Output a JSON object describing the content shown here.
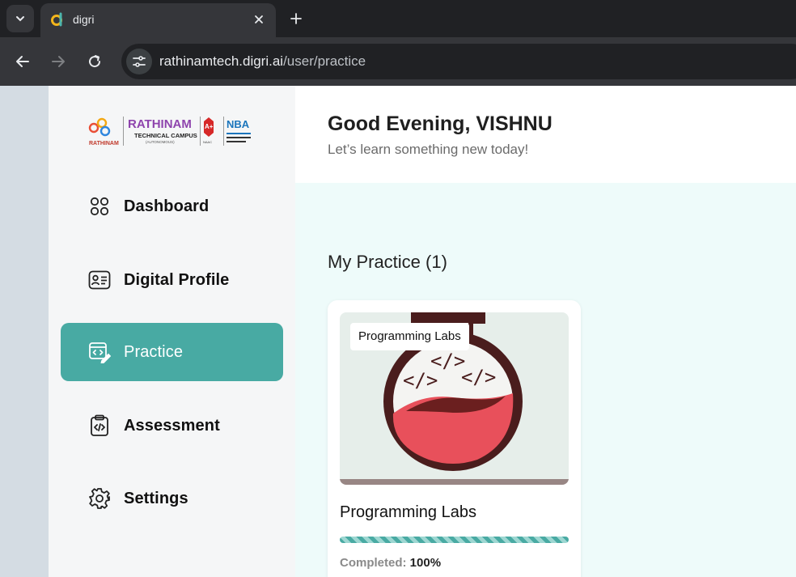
{
  "browser": {
    "tab_title": "digri",
    "url_host": "rathinamtech.digri.ai",
    "url_path": "/user/practice"
  },
  "sidebar": {
    "items": [
      {
        "label": "Dashboard",
        "icon": "grid-icon"
      },
      {
        "label": "Digital Profile",
        "icon": "id-card-icon"
      },
      {
        "label": "Practice",
        "icon": "code-edit-icon",
        "active": true
      },
      {
        "label": "Assessment",
        "icon": "clipboard-code-icon"
      },
      {
        "label": "Settings",
        "icon": "gear-icon"
      }
    ]
  },
  "header": {
    "greeting": "Good Evening, VISHNU",
    "subtitle": "Let’s learn something new today!"
  },
  "main": {
    "section_title": "My Practice (1)",
    "cards": [
      {
        "tag": "Programming Labs",
        "title": "Programming Labs",
        "completed_label": "Completed:",
        "completed_value": "100%",
        "progress": 1.0
      }
    ]
  },
  "colors": {
    "accent": "#48aaa3",
    "page_bg": "#eefbfa",
    "sidebar_bg": "#f5f6f7"
  }
}
